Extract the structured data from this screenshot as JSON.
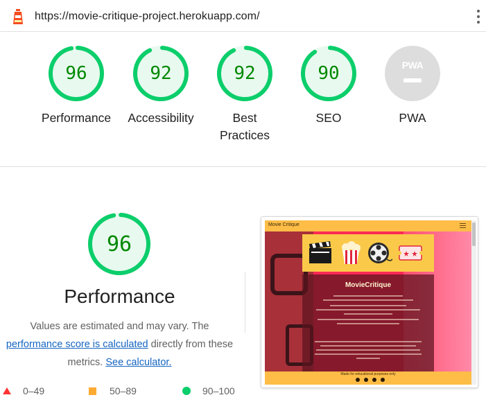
{
  "urlbar": {
    "url": "https://movie-critique-project.herokuapp.com/",
    "logo_icon": "lighthouse-icon",
    "menu_icon": "kebab-menu-icon"
  },
  "gauges": [
    {
      "score": "96",
      "label": "Performance",
      "color": "#0cce6b",
      "value": 0.96
    },
    {
      "score": "92",
      "label": "Accessibility",
      "color": "#0cce6b",
      "value": 0.92
    },
    {
      "score": "92",
      "label": "Best Practices",
      "color": "#0cce6b",
      "value": 0.92
    },
    {
      "score": "90",
      "label": "SEO",
      "color": "#0cce6b",
      "value": 0.9
    }
  ],
  "pwa": {
    "badge_text": "PWA",
    "label": "PWA",
    "color": "#dddddd"
  },
  "performance": {
    "score": "96",
    "value": 0.96,
    "title": "Performance",
    "desc_1": "Values are estimated and may vary. The",
    "link_score": "performance score is calculated",
    "desc_2": "directly from these",
    "desc_3": "metrics.",
    "link_calc": "See calculator."
  },
  "legend": {
    "fail": "0–49",
    "average": "50–89",
    "pass": "90–100",
    "fail_color": "#ff3333",
    "average_color": "#ffaa33",
    "pass_color": "#0cce6b"
  },
  "screenshot": {
    "brand": "Movie Critique",
    "card_title": "MovieCritique",
    "footer_text": "Made for educational purposes only"
  }
}
